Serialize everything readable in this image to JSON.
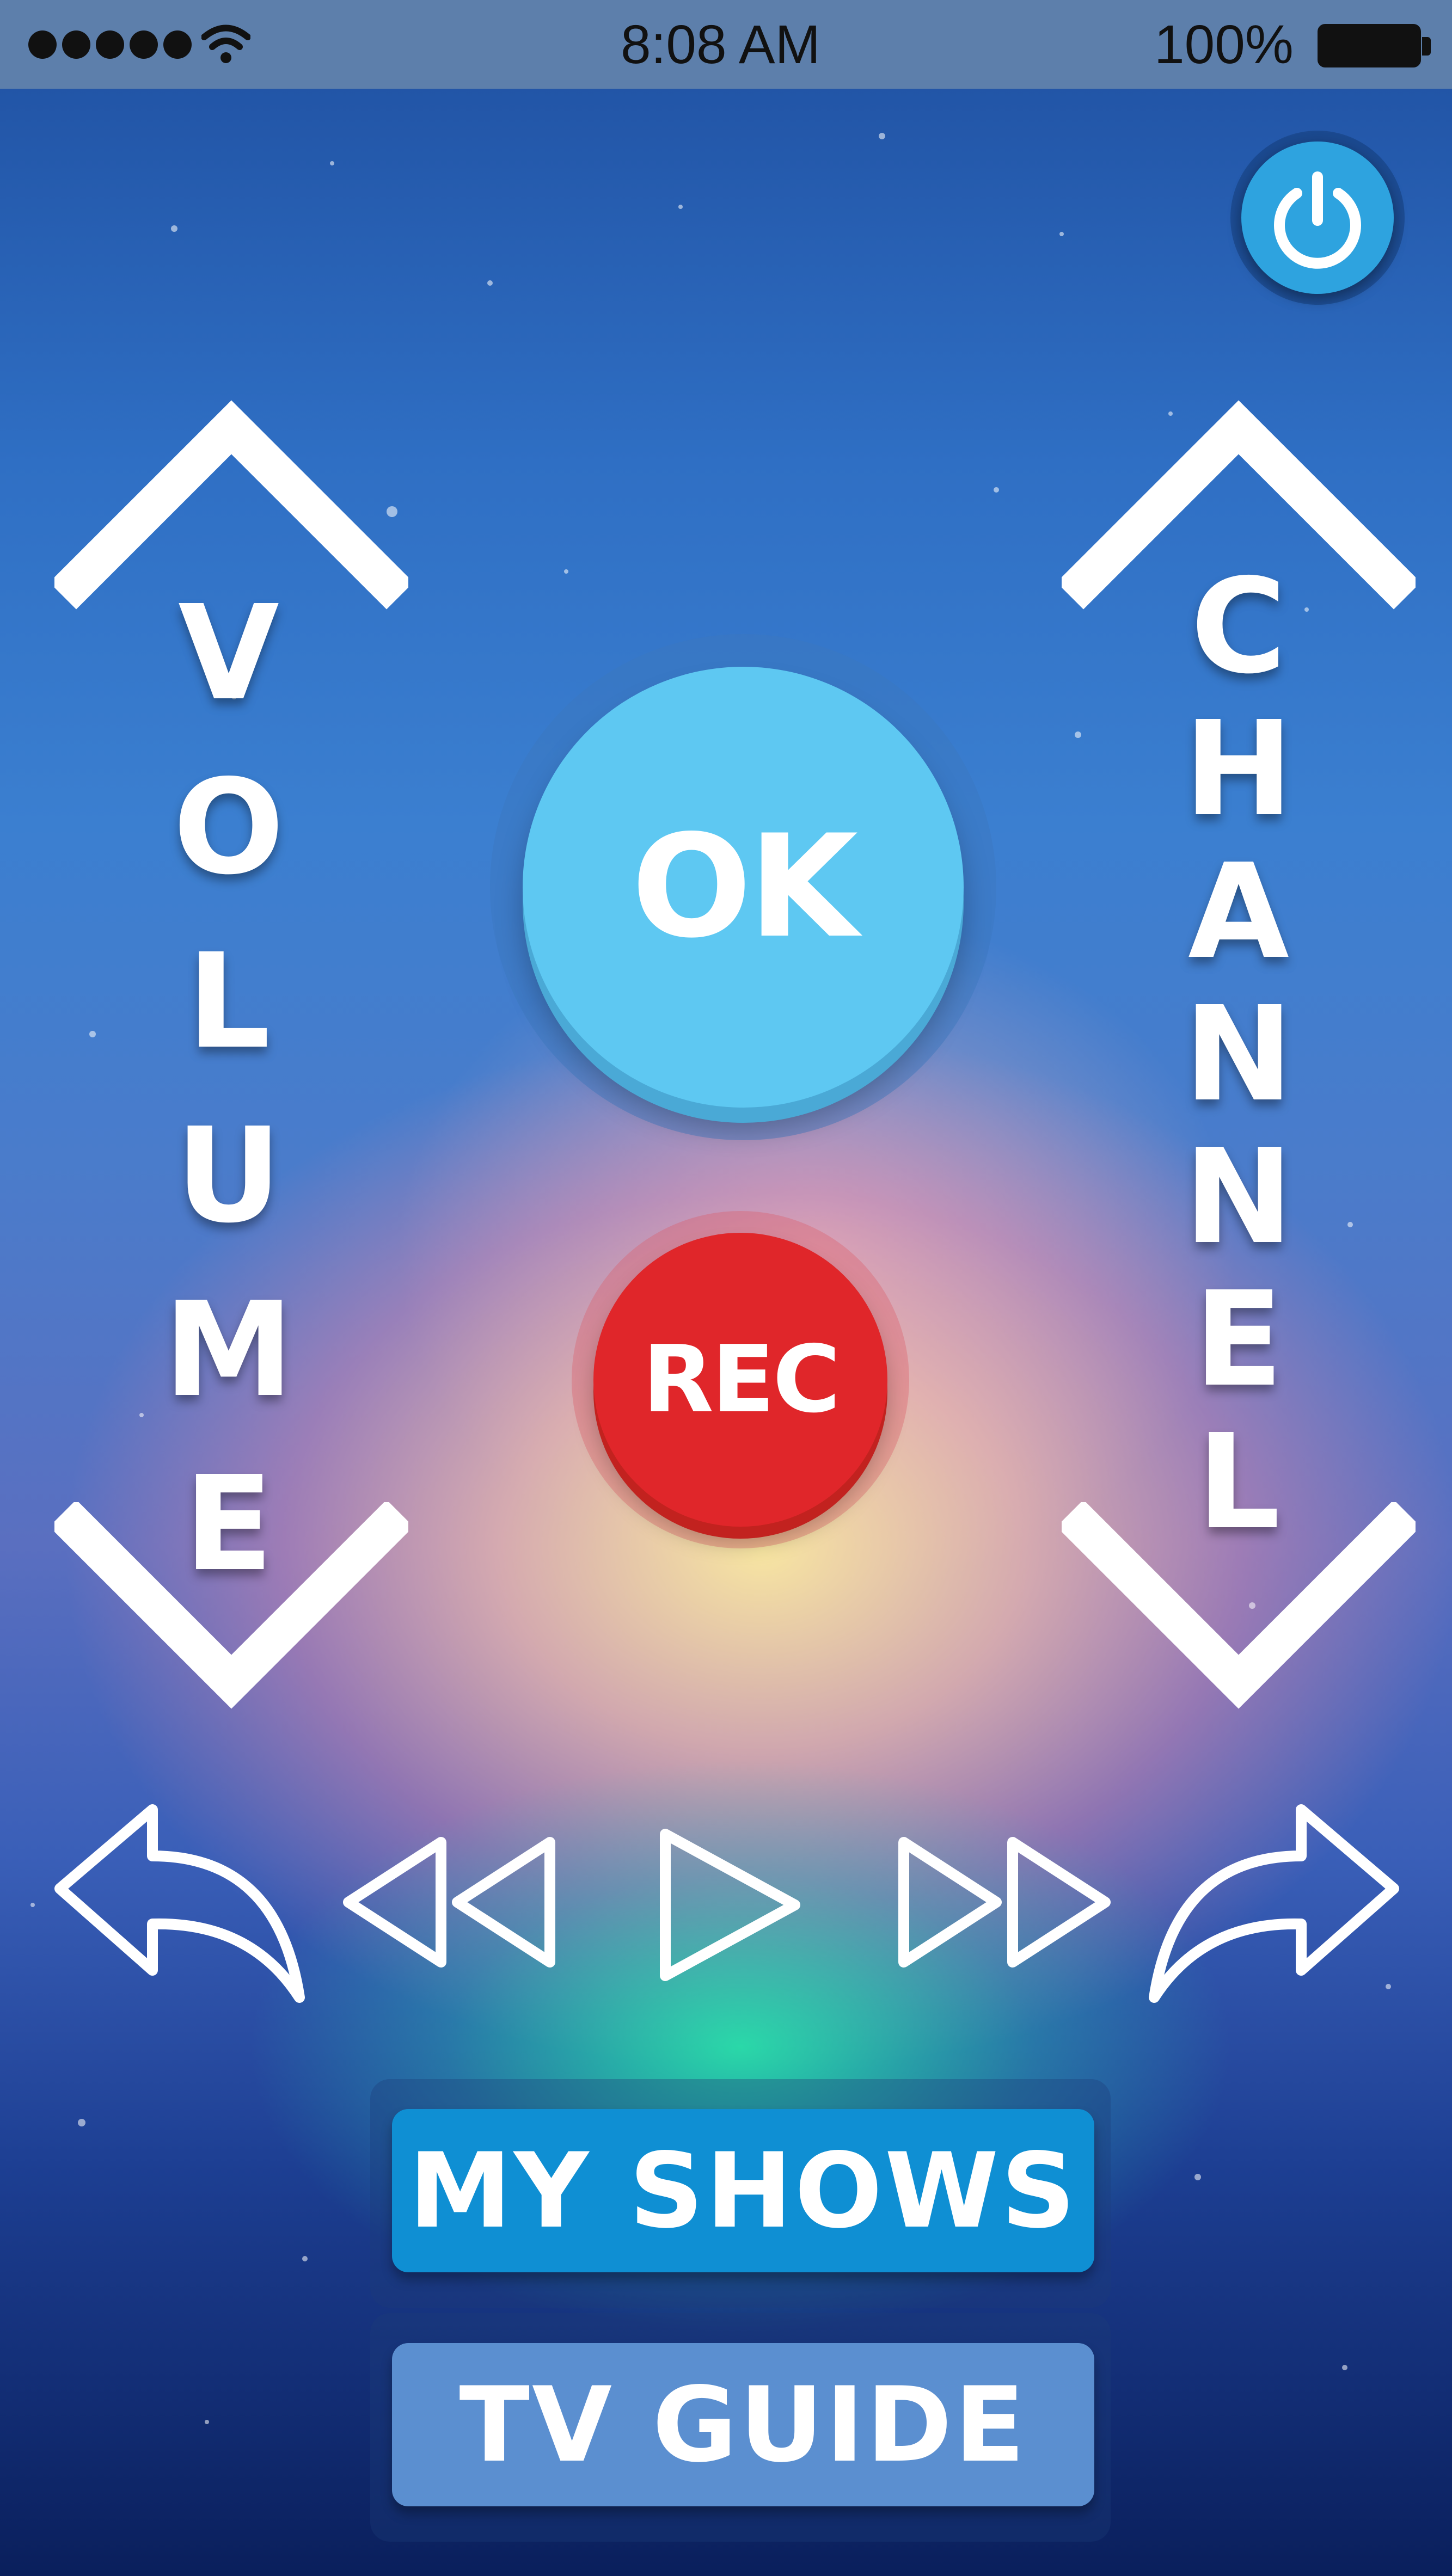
{
  "status_bar": {
    "signal_dots": 5,
    "time": "8:08 AM",
    "battery": "100%"
  },
  "icons": {
    "power": "power-icon",
    "volume_up": "chevron-up-icon",
    "volume_down": "chevron-down-icon",
    "channel_up": "chevron-up-icon",
    "channel_down": "chevron-down-icon",
    "back": "back-arrow-icon",
    "rewind": "rewind-icon",
    "play": "play-icon",
    "fast_forward": "fast-forward-icon",
    "forward": "forward-arrow-icon"
  },
  "labels": {
    "volume": [
      "V",
      "O",
      "L",
      "U",
      "M",
      "E"
    ],
    "channel": [
      "C",
      "H",
      "A",
      "N",
      "N",
      "E",
      "L"
    ],
    "ok": "OK",
    "rec": "REC",
    "my_shows": "MY SHOWS",
    "tv_guide": "TV GUIDE"
  },
  "colors": {
    "ok": "#5ec8f2",
    "rec": "#e0262a",
    "my_shows": "#0f8fd3",
    "tv_guide": "#5b8fd0",
    "power": "#2ea3df"
  }
}
